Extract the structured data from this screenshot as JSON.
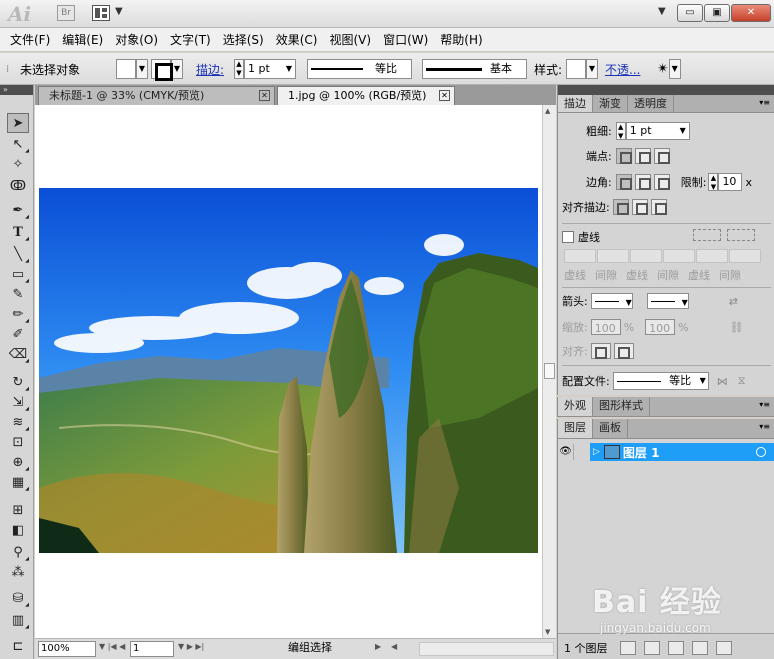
{
  "app": {
    "logo_text": "Ai",
    "bridge_label": "Br",
    "window_buttons": {
      "minimize": "▭",
      "restore": "▣",
      "close": "✕"
    }
  },
  "menubar": {
    "items": [
      "文件(F)",
      "编辑(E)",
      "对象(O)",
      "文字(T)",
      "选择(S)",
      "效果(C)",
      "视图(V)",
      "窗口(W)",
      "帮助(H)"
    ]
  },
  "controlbar": {
    "selection_label": "未选择对象",
    "stroke_label": "描边:",
    "stroke_weight": "1 pt",
    "profile_label": "等比",
    "brush_label": "基本",
    "style_label": "样式:",
    "opacity_label": "不透..."
  },
  "document_tabs": [
    {
      "title": "未标题-1 @ 33% (CMYK/预览)",
      "active": false
    },
    {
      "title": "1.jpg @ 100% (RGB/预览)",
      "active": true
    }
  ],
  "statusbar": {
    "zoom": "100%",
    "page": "1",
    "status": "编组选择"
  },
  "stroke_panel": {
    "tabs": [
      "描边",
      "渐变",
      "透明度"
    ],
    "weight_label": "粗细:",
    "weight_value": "1 pt",
    "cap_label": "端点:",
    "corner_label": "边角:",
    "limit_label": "限制:",
    "limit_value": "10",
    "limit_unit": "x",
    "align_label": "对齐描边:",
    "dashed_label": "虚线",
    "dash_labels": [
      "虚线",
      "间隙",
      "虚线",
      "间隙",
      "虚线",
      "间隙"
    ],
    "arrow_label": "箭头:",
    "scale_label": "缩放:",
    "scale_value_1": "100",
    "scale_value_2": "100",
    "percent": "%",
    "align_arrow_label": "对齐:",
    "profile_label": "配置文件:",
    "profile_value": "等比"
  },
  "appearance_panel": {
    "tabs": [
      "外观",
      "图形样式"
    ]
  },
  "layers_panel": {
    "tabs": [
      "图层",
      "画板"
    ],
    "layer_name": "图层 1",
    "footer_count": "1 个图层"
  },
  "watermark": {
    "main": "Bai  经验",
    "sub": "jingyan.baidu.com"
  },
  "colors": {
    "sky": "#1d6fe0",
    "layer_highlight": "#1f9ef7",
    "link_blue": "#1a33b8"
  }
}
